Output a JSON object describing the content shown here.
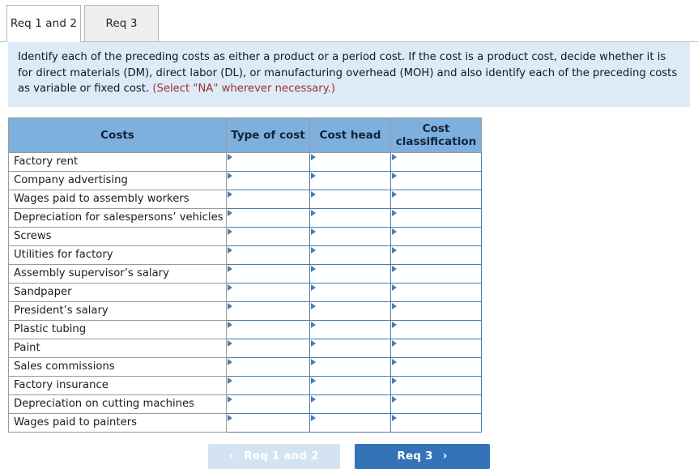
{
  "tabs": [
    {
      "label": "Req 1 and 2",
      "active": true
    },
    {
      "label": "Req 3",
      "active": false
    }
  ],
  "instructions": {
    "body": "Identify each of the preceding costs as either a product or a period cost. If the cost is a product cost, decide whether it is for direct materials (DM), direct labor (DL), or manufacturing overhead (MOH) and also identify each of the preceding costs as variable or fixed cost.",
    "note": "(Select \"NA\" wherever necessary.)",
    "background_color": "#dcebf7",
    "note_color": "#9c3030"
  },
  "table": {
    "headers": {
      "costs": "Costs",
      "type_of_cost": "Type of cost",
      "cost_head": "Cost head",
      "cost_classification": "Cost classification"
    },
    "header_color": "#7eb0de",
    "rows": [
      {
        "cost": "Factory rent",
        "type_of_cost": "",
        "cost_head": "",
        "cost_classification": ""
      },
      {
        "cost": "Company advertising",
        "type_of_cost": "",
        "cost_head": "",
        "cost_classification": ""
      },
      {
        "cost": "Wages paid to assembly workers",
        "type_of_cost": "",
        "cost_head": "",
        "cost_classification": ""
      },
      {
        "cost": "Depreciation for salespersons’ vehicles",
        "type_of_cost": "",
        "cost_head": "",
        "cost_classification": ""
      },
      {
        "cost": "Screws",
        "type_of_cost": "",
        "cost_head": "",
        "cost_classification": ""
      },
      {
        "cost": "Utilities for factory",
        "type_of_cost": "",
        "cost_head": "",
        "cost_classification": ""
      },
      {
        "cost": "Assembly supervisor’s salary",
        "type_of_cost": "",
        "cost_head": "",
        "cost_classification": ""
      },
      {
        "cost": "Sandpaper",
        "type_of_cost": "",
        "cost_head": "",
        "cost_classification": ""
      },
      {
        "cost": "President’s salary",
        "type_of_cost": "",
        "cost_head": "",
        "cost_classification": ""
      },
      {
        "cost": "Plastic tubing",
        "type_of_cost": "",
        "cost_head": "",
        "cost_classification": ""
      },
      {
        "cost": "Paint",
        "type_of_cost": "",
        "cost_head": "",
        "cost_classification": ""
      },
      {
        "cost": "Sales commissions",
        "type_of_cost": "",
        "cost_head": "",
        "cost_classification": ""
      },
      {
        "cost": "Factory insurance",
        "type_of_cost": "",
        "cost_head": "",
        "cost_classification": ""
      },
      {
        "cost": "Depreciation on cutting machines",
        "type_of_cost": "",
        "cost_head": "",
        "cost_classification": ""
      },
      {
        "cost": "Wages paid to painters",
        "type_of_cost": "",
        "cost_head": "",
        "cost_classification": ""
      }
    ]
  },
  "footer": {
    "prev": {
      "label": "Req 1 and 2",
      "icon": "chevron-left-icon",
      "glyph": "‹",
      "disabled": true,
      "color": "#d3e3f1"
    },
    "next": {
      "label": "Req 3",
      "icon": "chevron-right-icon",
      "glyph": "›",
      "disabled": false,
      "color": "#3573b9"
    }
  }
}
